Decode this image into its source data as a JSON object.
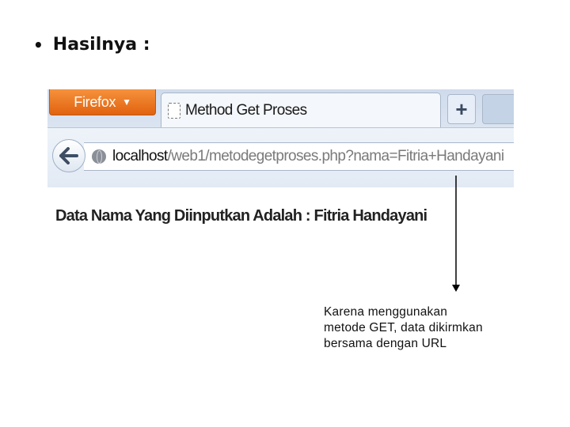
{
  "slide": {
    "bullet": "•",
    "heading": "Hasilnya :"
  },
  "browser": {
    "menu_button_label": "Firefox",
    "menu_button_arrow": "▼",
    "tab_title": "Method Get Proses",
    "new_tab_symbol": "+",
    "url_host": "localhost",
    "url_path": "/web1/metodegetproses.php?nama=Fitria+Handayani",
    "icons": [
      "back-arrow-icon",
      "globe-icon",
      "blank-page-icon"
    ]
  },
  "page": {
    "output_text": "Data Nama Yang Diinputkan Adalah : Fitria Handayani"
  },
  "annotation": {
    "caption_lines": [
      "Karena menggunakan",
      "metode GET, data dikirmkan",
      "bersama dengan URL"
    ]
  }
}
